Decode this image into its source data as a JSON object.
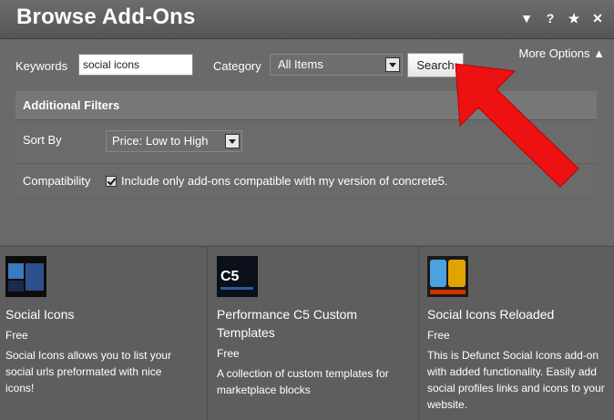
{
  "window": {
    "title": "Browse Add-Ons"
  },
  "titlebar_icons": [
    "chevron-down-icon",
    "help-icon",
    "star-icon",
    "close-icon"
  ],
  "titlebar_glyphs": {
    "collapse": "▼",
    "help": "?",
    "favorite": "★",
    "close": "✕"
  },
  "search": {
    "keywords_label": "Keywords",
    "keywords_value": "social icons",
    "category_label": "Category",
    "category_value": "All Items",
    "search_button": "Search",
    "more_options": "More Options ▲"
  },
  "filters": {
    "header": "Additional Filters",
    "sort_label": "Sort By",
    "sort_value": "Price: Low to High",
    "compat_label": "Compatibility",
    "compat_text": "Include only add-ons compatible with my version of concrete5.",
    "compat_checked": true
  },
  "addons": [
    {
      "title": "Social Icons",
      "price": "Free",
      "description": "Social Icons allows you to list your social urls preformated with nice icons!"
    },
    {
      "title": "Performance C5 Custom Templates",
      "price": "Free",
      "description": "A collection of custom templates for marketplace blocks"
    },
    {
      "title": "Social Icons Reloaded",
      "price": "Free",
      "description": "This is Defunct Social Icons add-on with added functionality. Easily add social profiles links and icons to your website."
    }
  ],
  "thumb_text": {
    "c5": "C5"
  },
  "accent_colors": {
    "arrow": "#ee1111"
  }
}
